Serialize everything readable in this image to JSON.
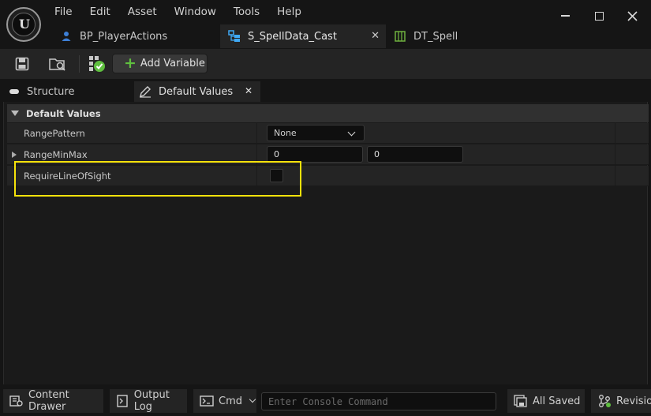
{
  "app": {
    "menu": [
      "File",
      "Edit",
      "Asset",
      "Window",
      "Tools",
      "Help"
    ],
    "logo_letter": "U"
  },
  "tabs": [
    {
      "label": "BP_PlayerActions",
      "icon": "person-icon",
      "active": false
    },
    {
      "label": "S_SpellData_Cast",
      "icon": "struct-icon",
      "active": true
    },
    {
      "label": "DT_Spell",
      "icon": "datatable-icon",
      "active": false
    }
  ],
  "toolbar": {
    "add_variable_label": "Add Variable",
    "add_icon_glyph": "+"
  },
  "panels": {
    "structure_label": "Structure",
    "default_values_label": "Default Values"
  },
  "details": {
    "section_title": "Default Values",
    "properties": [
      {
        "name": "RangePattern",
        "value": "None"
      },
      {
        "name": "RangeMinMax",
        "min": "0",
        "max": "0"
      },
      {
        "name": "RequireLineOfSight",
        "checked": false
      }
    ]
  },
  "statusbar": {
    "content_drawer": "Content Drawer",
    "output_log": "Output Log",
    "cmd": "Cmd",
    "console_placeholder": "Enter Console Command",
    "all_saved": "All Saved",
    "revision": "Revision"
  },
  "colors": {
    "highlight": "#f5e20a",
    "accent_green": "#5fbf3f",
    "struct_icon_blue": "#3fa9f5"
  }
}
